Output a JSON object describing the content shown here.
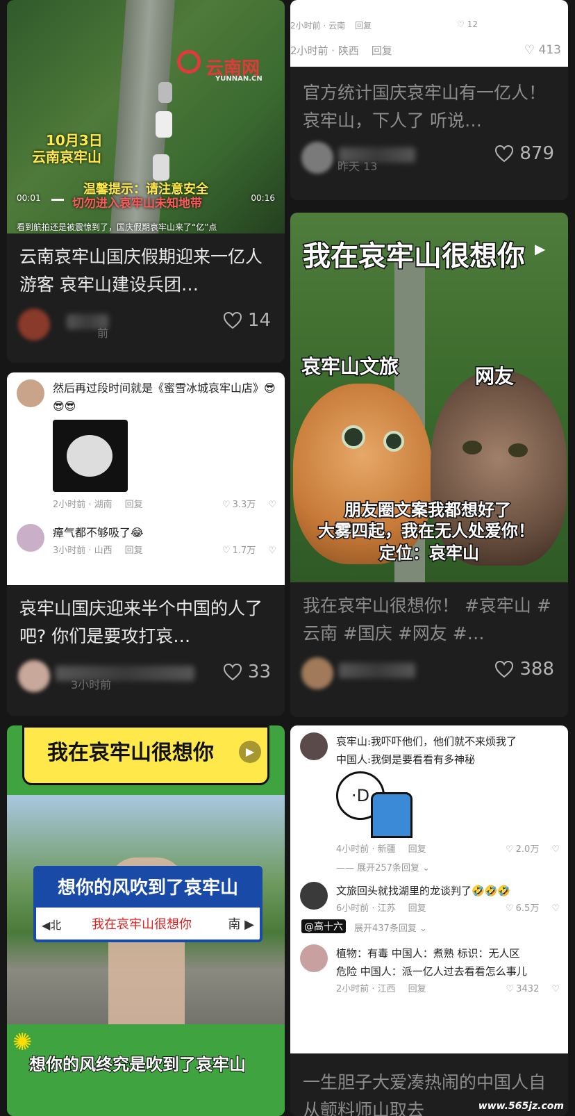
{
  "feed": {
    "left": [
      {
        "video": {
          "logo": "云南网",
          "logo_sub": "YUNNAN.CN",
          "date_label": "10月3日",
          "place_label": "云南哀牢山",
          "tip_line1": "温馨提示：请注意安全",
          "tip_line2": "切勿进入哀牢山未知地带",
          "time_start": "00:01",
          "time_end": "00:16",
          "subtitle": "看到航拍还是被震惊到了，国庆假期哀牢山来了“亿”点"
        },
        "title": "云南哀牢山国庆假期迎来一亿人游客 哀牢山建设兵团…",
        "time": "前",
        "likes": "14"
      },
      {
        "comments": [
          {
            "text": "然后再过段时间就是《蜜雪冰城哀牢山店》😎😎😎",
            "time": "2小时前 · 湖南",
            "reply": "回复",
            "likes": "3.3万"
          },
          {
            "text": "瘴气都不够吸了😂",
            "time": "3小时前 · 山西",
            "reply": "回复",
            "likes": "1.7万"
          }
        ],
        "title": "哀牢山国庆迎来半个中国的人了吧? 你们是要攻打哀…",
        "time": "3小时前",
        "likes": "33"
      },
      {
        "banner": "我在哀牢山很想你",
        "sign_main": "想你的风吹到了哀牢山",
        "sign_sub": "我在哀牢山很想你",
        "sign_left": "◀北",
        "sign_right": "南 ▶",
        "bottom_caption": "想你的风终究是吹到了哀牢山"
      }
    ],
    "right": [
      {
        "comment_strip": [
          {
            "time": "2小时前 · 云南",
            "reply": "回复",
            "likes": "12"
          },
          {
            "time": "2小时前 · 陕西",
            "reply": "回复",
            "likes": "413"
          }
        ],
        "title": "官方统计国庆哀牢山有一亿人！ 哀牢山，下人了 听说…",
        "time": "昨天 13",
        "likes": "879"
      },
      {
        "meme_title": "我在哀牢山很想你",
        "left_cat_label": "哀牢山文旅",
        "right_cat_label": "网友",
        "bottom_line1": "朋友圈文案我都想好了",
        "bottom_line2": "大雾四起，我在无人处爱你！",
        "bottom_line3": "定位：哀牢山",
        "title": "我在哀牢山很想你！ #哀牢山 #云南 #国庆 #网友 #…",
        "likes": "388"
      },
      {
        "comments": [
          {
            "text": "哀牢山:我吓吓他们，他们就不来烦我了\n中国人:我倒是要看看有多神秘",
            "time": "4小时前 · 新疆",
            "reply": "回复",
            "likes": "2.0万",
            "expand": "展开257条回复"
          },
          {
            "text": "文旅回头就找湖里的龙谈判了🤣🤣🤣",
            "time": "6小时前 · 江苏",
            "reply": "回复",
            "likes": "6.5万",
            "expand": "展开437条回复",
            "tag": "@高十六"
          },
          {
            "text": "植物：有毒 中国人：煮熟 标识：无人区\n危险 中国人：派一亿人过去看看怎么事儿",
            "time": "2小时前 · 江西",
            "reply": "回复",
            "likes": "3432"
          }
        ],
        "title": "一生胆子大爱凑热闹的中国人自从颤料师山取去"
      }
    ],
    "watermark": "www.565jz.com"
  },
  "colors": {
    "bg": "#161616",
    "card": "#1e1e1e",
    "text": "#e9e9e9",
    "muted": "#8c8c8c",
    "red": "#e02020",
    "yellow": "#ffde00"
  }
}
